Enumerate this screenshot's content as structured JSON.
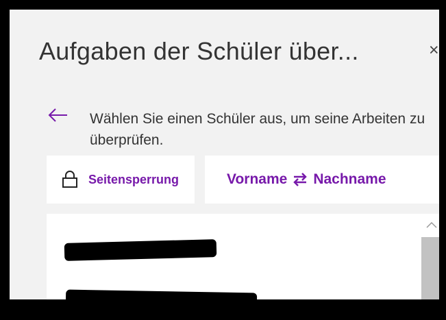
{
  "panel": {
    "title": "Aufgaben der Schüler über...",
    "close_label": "×",
    "back_icon": "arrow-left-icon",
    "instruction": "Wählen Sie einen Schüler aus, um seine Arbeiten zu überprüfen."
  },
  "toolbar": {
    "lock_icon": "lock-icon",
    "lock_label": "Seitensperrung",
    "sort_first": "Vorname",
    "sort_swap_icon": "swap-icon",
    "sort_second": "Nachname"
  },
  "colors": {
    "accent": "#7719aa",
    "panel_bg": "#f2f2f2",
    "card_bg": "#ffffff",
    "text": "#333333"
  }
}
